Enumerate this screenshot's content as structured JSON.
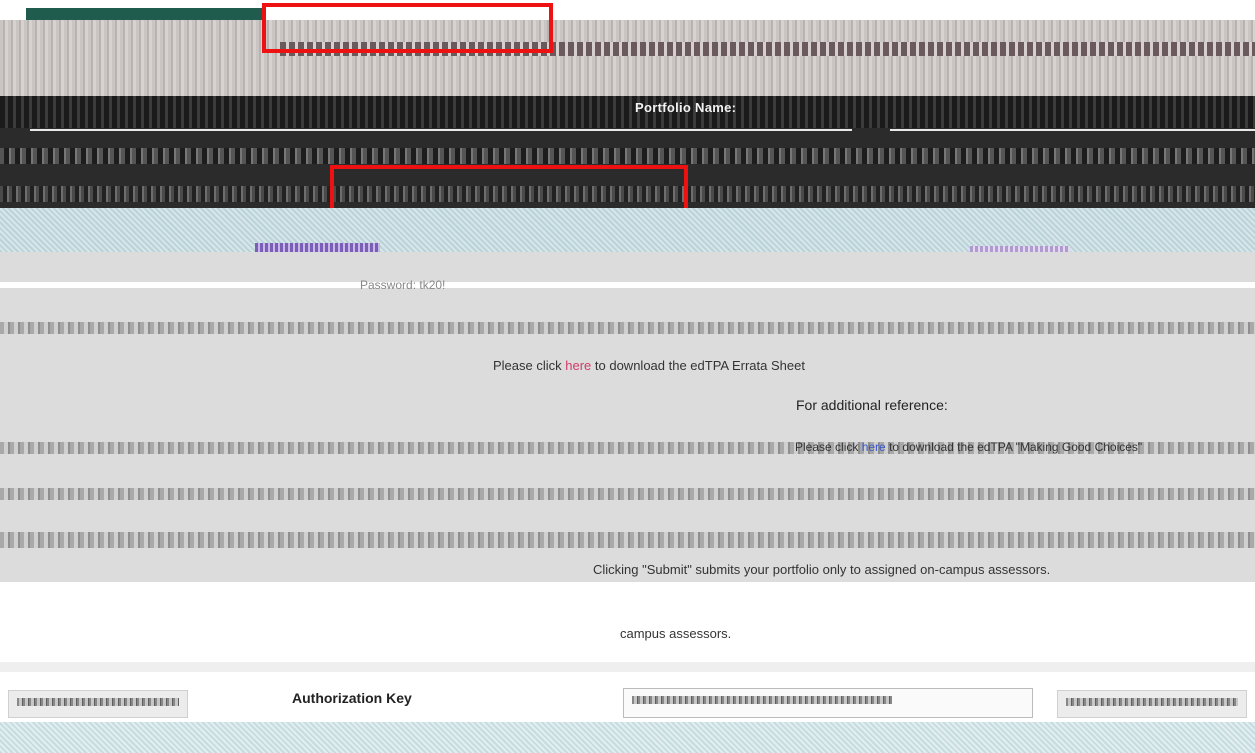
{
  "header": {
    "portfolio_label": "Portfolio Name:"
  },
  "access": {
    "password_line": "Password: tk20!"
  },
  "errata": {
    "prefix": "Please click ",
    "link": "here",
    "suffix": " to download the edTPA Errata Sheet"
  },
  "reference": {
    "heading": "For additional reference:",
    "making_prefix": "Please click ",
    "making_link": "here",
    "making_suffix": " to download the edTPA \"Making Good Choices\""
  },
  "submit": {
    "note": "Clicking \"Submit\" submits your portfolio only to assigned on-campus assessors.",
    "note_tail": "campus assessors."
  },
  "auth": {
    "label": "Authorization Key"
  },
  "colors": {
    "brand_green": "#1f5c4e",
    "annotation_red": "#ee1111",
    "link_pink": "#d23c6b",
    "link_blue": "#3a57c9"
  }
}
